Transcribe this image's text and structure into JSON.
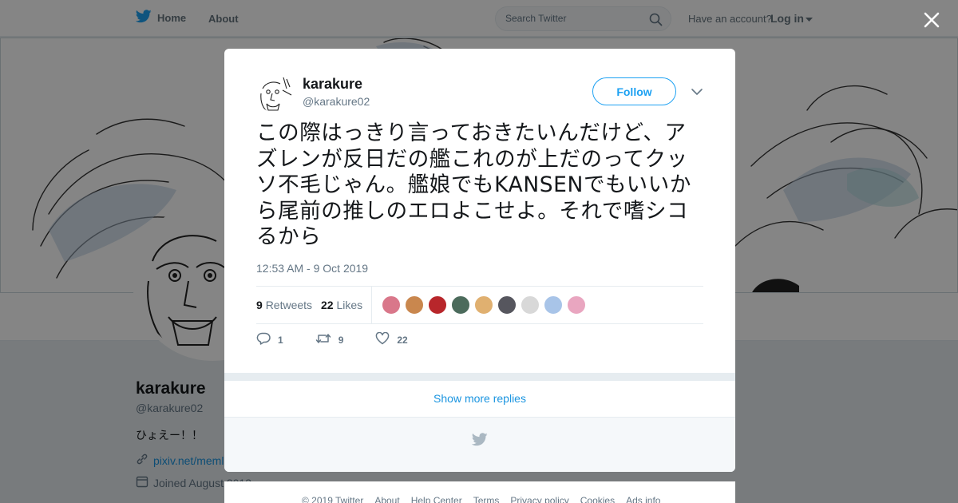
{
  "nav": {
    "home": "Home",
    "about": "About",
    "search_placeholder": "Search Twitter",
    "have_account": "Have an account?",
    "login": "Log in"
  },
  "profile": {
    "name": "karakure",
    "handle": "@karakure02",
    "bio": "ひょえー！！",
    "link": "pixiv.net/meml",
    "joined": "Joined August 2013"
  },
  "tweet": {
    "author_name": "karakure",
    "author_handle": "@karakure02",
    "follow_label": "Follow",
    "text": "この際はっきり言っておきたいんだけど、アズレンが反日だの艦これのが上だのってクッソ不毛じゃん。艦娘でもKANSENでもいいから尾前の推しのエロよこせよ。それで嗜シコるから",
    "timestamp": "12:53 AM - 9 Oct 2019",
    "retweets_count": "9",
    "retweets_label": "Retweets",
    "likes_count": "22",
    "likes_label": "Likes",
    "reply_count": "1",
    "retweet_count_action": "9",
    "like_count_action": "22",
    "liker_colors": [
      "#d9778a",
      "#c9874e",
      "#b8262b",
      "#4c6b5c",
      "#e0b070",
      "#56565e",
      "#d8d8d8",
      "#a8c4e8",
      "#e9a6c0"
    ]
  },
  "modal": {
    "show_more": "Show more replies"
  },
  "footer": {
    "links": [
      "© 2019 Twitter",
      "About",
      "Help Center",
      "Terms",
      "Privacy policy",
      "Cookies",
      "Ads info"
    ]
  },
  "colors": {
    "accent": "#1da1f2",
    "link": "#1b95e0",
    "secondary_text": "#657786"
  }
}
